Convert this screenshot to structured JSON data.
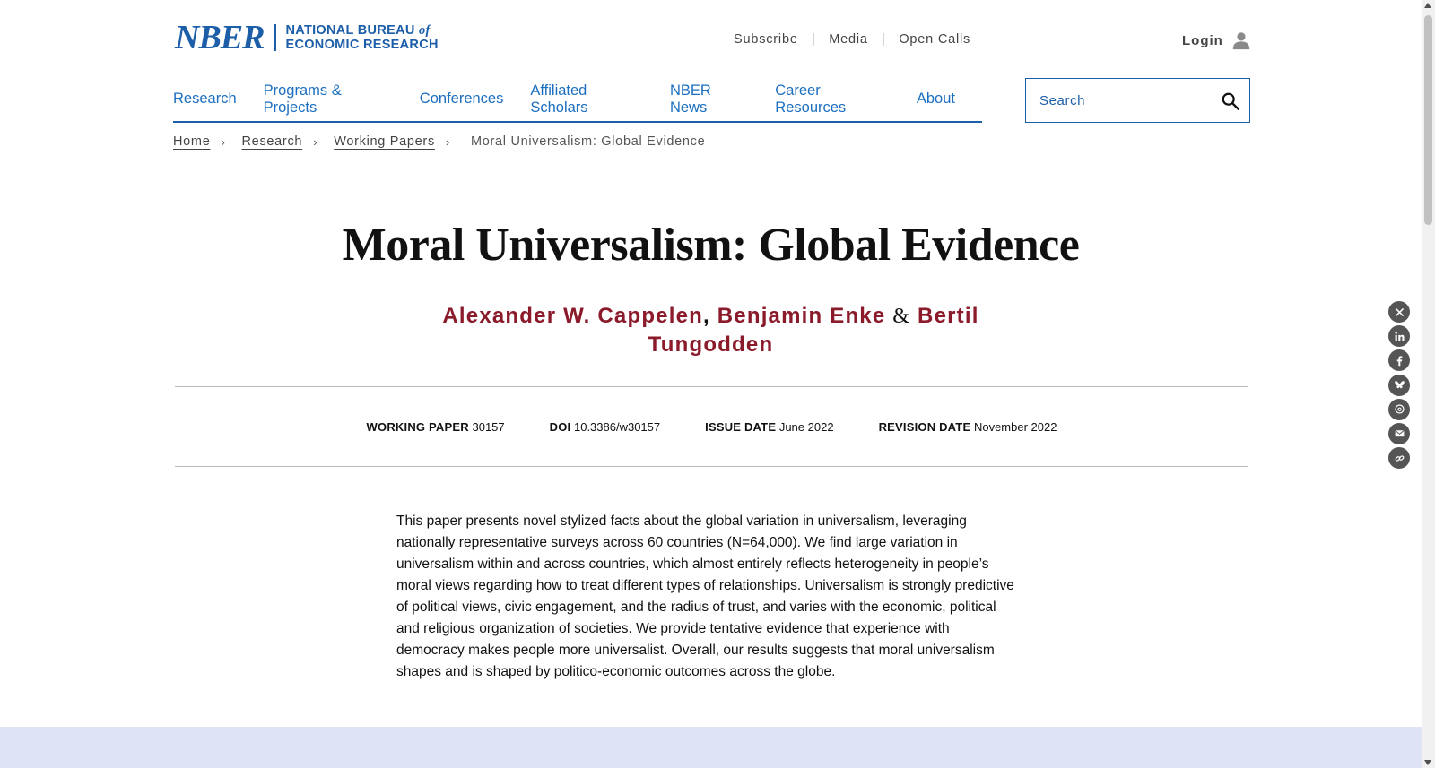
{
  "header": {
    "logo_mark": "NBER",
    "logo_line1_prefix": "NATIONAL BUREAU",
    "logo_line1_suffix": "of",
    "logo_line2": "ECONOMIC RESEARCH",
    "utility_links": [
      "Subscribe",
      "Media",
      "Open Calls"
    ],
    "utility_separator": "|",
    "login_label": "Login"
  },
  "nav": {
    "items": [
      "Research",
      "Programs & Projects",
      "Conferences",
      "Affiliated Scholars",
      "NBER News",
      "Career Resources",
      "About"
    ]
  },
  "search": {
    "placeholder": "Search"
  },
  "breadcrumb": {
    "items": [
      "Home",
      "Research",
      "Working Papers"
    ],
    "current": "Moral Universalism: Global Evidence",
    "separator": "›"
  },
  "paper": {
    "title": "Moral Universalism: Global Evidence",
    "authors": [
      "Alexander W. Cappelen",
      "Benjamin Enke",
      "Bertil Tungodden"
    ],
    "author_comma": ",",
    "author_amp": "&",
    "meta": {
      "working_paper_label": "WORKING PAPER",
      "working_paper_value": "30157",
      "doi_label": "DOI",
      "doi_value": "10.3386/w30157",
      "issue_date_label": "ISSUE DATE",
      "issue_date_value": "June 2022",
      "revision_date_label": "REVISION DATE",
      "revision_date_value": "November 2022"
    },
    "abstract": "This paper presents novel stylized facts about the global variation in universalism, leveraging nationally representative surveys across 60 countries (N=64,000). We find large variation in universalism within and across countries, which almost entirely reflects heterogeneity in people’s moral views regarding how to treat different types of relationships. Universalism is strongly predictive of political views, civic engagement, and the radius of trust, and varies with the economic, political and religious organization of societies. We provide tentative evidence that experience with democracy makes people more universalist. Overall, our results suggests that moral universalism shapes and is shaped by politico-economic outcomes across the globe."
  },
  "share": {
    "icons": [
      "x-twitter-icon",
      "linkedin-icon",
      "facebook-icon",
      "bluesky-icon",
      "threads-icon",
      "email-icon",
      "copy-link-icon"
    ]
  },
  "colors": {
    "brand_blue": "#1c5ea8",
    "link_blue": "#1c6fc0",
    "author_red": "#8b1a2b",
    "footer_band": "#dfe3f6"
  }
}
